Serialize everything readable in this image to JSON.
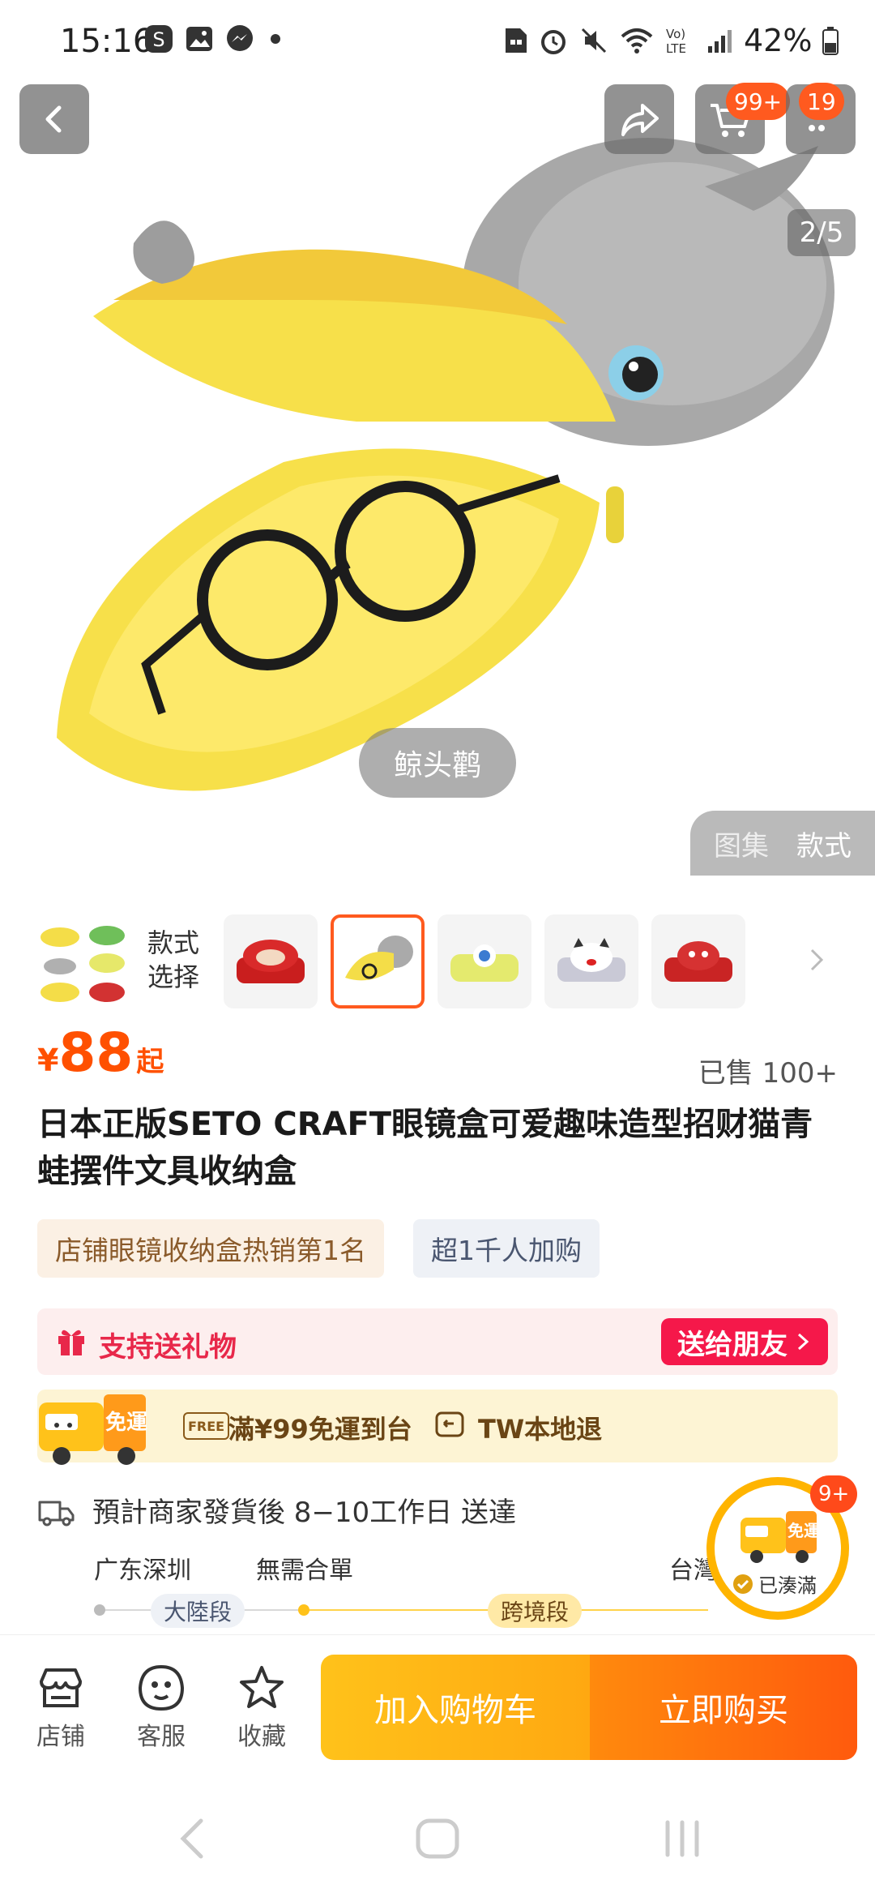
{
  "status_bar": {
    "time": "15:16",
    "battery": "42%",
    "icons": [
      "samsung-icon",
      "gallery-icon",
      "messenger-icon",
      "dot-icon",
      "sim-icon",
      "alarm-icon",
      "mute-icon",
      "wifi-icon",
      "volte-icon",
      "signal-icon",
      "battery-icon"
    ]
  },
  "header": {
    "cart_badge": "99+",
    "msg_badge": "19"
  },
  "gallery": {
    "counter": "2/5",
    "caption": "鲸头鹳",
    "tabs": [
      "图集",
      "款式"
    ]
  },
  "variants": {
    "label_line1": "款式",
    "label_line2": "选择",
    "selected_index": 1
  },
  "product": {
    "currency": "¥",
    "price": "88",
    "price_suffix": "起",
    "sold": "已售 100+",
    "title": "日本正版SETO CRAFT眼镜盒可爱趣味造型招财猫青蛙摆件文具收纳盒",
    "tags": [
      "店铺眼镜收纳盒热销第1名",
      "超1千人加购"
    ]
  },
  "gift": {
    "text": "支持送礼物",
    "button": "送给朋友"
  },
  "shipping": {
    "truck_label": "免運",
    "free_badge": "FREE",
    "free_text": "滿¥99免運到台",
    "return_text": "TW本地退"
  },
  "delivery": {
    "text": "預計商家發貨後 8−10工作日 送達",
    "origin": "广东深圳",
    "no_merge": "無需合單",
    "destination": "台灣",
    "segment_mainland": "大陸段",
    "segment_cross": "跨境段"
  },
  "float": {
    "badge": "9+",
    "truck_label": "免運",
    "status": "已湊滿"
  },
  "bottom_bar": {
    "store": "店铺",
    "service": "客服",
    "favorite": "收藏",
    "add_cart": "加入购物车",
    "buy_now": "立即购买"
  },
  "colors": {
    "accent": "#ff5000",
    "gift_red": "#f5184a",
    "yellow": "#ffc21a"
  }
}
